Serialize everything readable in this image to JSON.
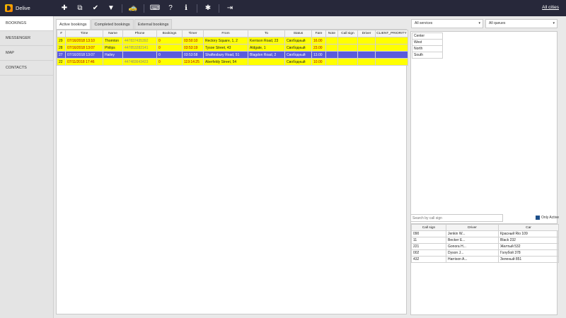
{
  "app": {
    "name": "Delive",
    "cities_link": "All cities"
  },
  "toolbar": {
    "icons": [
      "plus-icon",
      "copy-icon",
      "check-icon",
      "filter-icon",
      "taxi-icon",
      "keyboard-icon",
      "help-icon",
      "info-icon",
      "bug-icon",
      "logout-icon"
    ],
    "glyphs": [
      "✚",
      "⧉",
      "✔",
      "▼",
      "🚕",
      "⌨",
      "?",
      "ℹ",
      "✱",
      "⇥"
    ]
  },
  "sidebar": {
    "items": [
      {
        "label": "BOOKINGS",
        "active": true
      },
      {
        "label": "MESSENGER",
        "active": false
      },
      {
        "label": "MAP",
        "active": false
      },
      {
        "label": "CONTACTS",
        "active": false
      }
    ]
  },
  "tabs": [
    {
      "label": "Active bookings",
      "active": true
    },
    {
      "label": "Completed bookings",
      "active": false
    },
    {
      "label": "External bookings",
      "active": false
    }
  ],
  "bookings": {
    "columns": [
      "#",
      "Time",
      "Name",
      "Phone",
      "Bookings",
      "Timer",
      "From",
      "To",
      "Status",
      "Fare",
      "Note",
      "Call sign",
      "Driver",
      "CLIENT_PRIORITY"
    ],
    "rows": [
      {
        "id": "29",
        "time": "07/16/2018 13:10",
        "name": "Thornton",
        "phone": "447837435392",
        "bookings": "0",
        "timer": "03:50:10",
        "from": "Rectory Square, 1, 2",
        "to": "Kerrison Road, 23",
        "status": "Свободный",
        "fare": "16.00",
        "note": "",
        "call_sign": "",
        "driver": "",
        "priority": "",
        "style": "yellow"
      },
      {
        "id": "28",
        "time": "07/16/2018 13:07",
        "name": "Philips",
        "phone": "447853282141",
        "bookings": "0",
        "timer": "03:53:19",
        "from": "Tysoe Street, 43",
        "to": "Aldgate, 1",
        "status": "Свободный",
        "fare": "23.00",
        "note": "",
        "call_sign": "",
        "driver": "",
        "priority": "",
        "style": "yellow"
      },
      {
        "id": "27",
        "time": "07/16/2018 13:07",
        "name": "Hailey",
        "phone": "",
        "bookings": "0",
        "timer": "03:53:58",
        "from": "Shaftesbury Road, 51",
        "to": "Blagdon Road, 2",
        "status": "Свободный",
        "fare": "13.00",
        "note": "",
        "call_sign": "",
        "driver": "",
        "priority": "",
        "style": "selected"
      },
      {
        "id": "22",
        "time": "07/11/2018 17:46",
        "name": "",
        "phone": "447483643423",
        "bookings": "0",
        "timer": "119:14:25",
        "from": "Aberfeldy Street, 54",
        "to": "",
        "status": "Свободный",
        "fare": "10.00",
        "note": "",
        "call_sign": "",
        "driver": "",
        "priority": "",
        "style": "yellow"
      }
    ]
  },
  "filters": {
    "services": "All services",
    "queues": "All queues"
  },
  "regions": [
    "Center",
    "West",
    "North",
    "South"
  ],
  "driver_search": {
    "placeholder": "Search by call sign",
    "only_active_label": "Only Active"
  },
  "drivers": {
    "columns": [
      "Call sign",
      "Driver",
      "Car"
    ],
    "rows": [
      {
        "call_sign": "090",
        "driver": "Jenkin W...",
        "car": "Красный Rio 109"
      },
      {
        "call_sign": "11",
        "driver": "Becker E...",
        "car": "Black 232"
      },
      {
        "call_sign": "221",
        "driver": "Gonora H...",
        "car": "Желтый 532"
      },
      {
        "call_sign": "002",
        "driver": "Dyson J...",
        "car": "Голубой 378"
      },
      {
        "call_sign": "432",
        "driver": "Harrison A...",
        "car": "Зеленый 851"
      }
    ]
  }
}
